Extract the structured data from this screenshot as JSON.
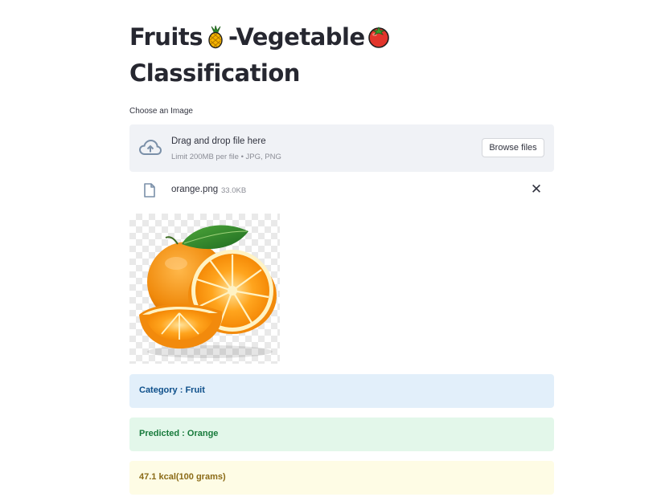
{
  "page": {
    "title_part1": "Fruits",
    "title_part2": "-Vegetable",
    "title_line2": "Classification",
    "title_emoji1": "pineapple-emoji",
    "title_emoji2": "tomato-emoji"
  },
  "uploader": {
    "label": "Choose an Image",
    "drop_text": "Drag and drop file here",
    "limit_text": "Limit 200MB per file • JPG, PNG",
    "browse_label": "Browse files",
    "cloud_icon": "cloud-upload-icon"
  },
  "file": {
    "name": "orange.png",
    "size": "33.0KB",
    "file_icon": "file-icon",
    "remove_icon": "close-icon"
  },
  "image": {
    "alt": "orange fruit image"
  },
  "results": {
    "category": "Category : Fruit",
    "predicted": "Predicted : Orange",
    "calories": "47.1 kcal(100 grams)"
  },
  "colors": {
    "info_bg": "#e2effa",
    "success_bg": "#e3f7ea",
    "warning_bg": "#fefce5",
    "dropzone_bg": "#f0f2f6"
  }
}
